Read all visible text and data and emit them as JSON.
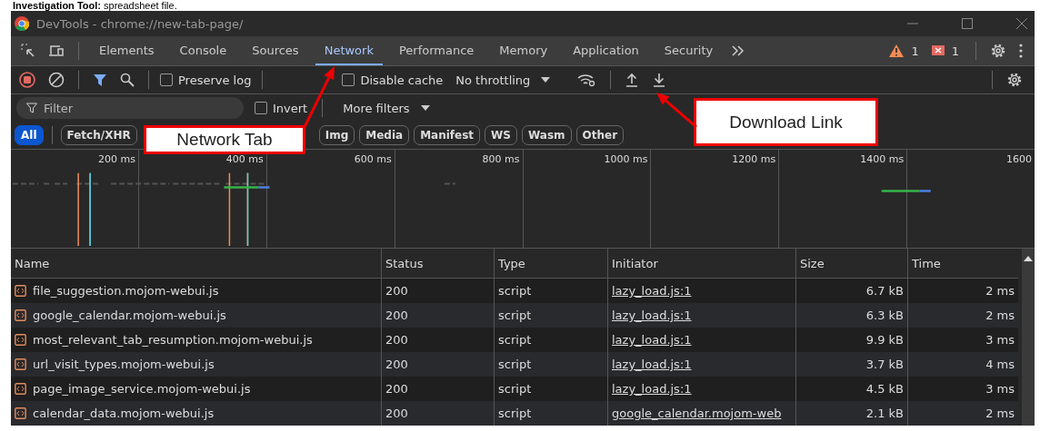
{
  "caption": "**Investigation Tool:** spreadsheet file.",
  "window": {
    "title": "DevTools - chrome://new-tab-page/"
  },
  "tabs": [
    {
      "label": "Elements",
      "selected": false
    },
    {
      "label": "Console",
      "selected": false
    },
    {
      "label": "Sources",
      "selected": false
    },
    {
      "label": "Network",
      "selected": true
    },
    {
      "label": "Performance",
      "selected": false
    },
    {
      "label": "Memory",
      "selected": false
    },
    {
      "label": "Application",
      "selected": false
    },
    {
      "label": "Security",
      "selected": false
    }
  ],
  "issues": {
    "warnings": "1",
    "errors": "1"
  },
  "toolbar": {
    "recording": true,
    "preserve_log": {
      "label": "Preserve log",
      "checked": false
    },
    "disable_cache": {
      "label": "Disable cache",
      "checked": false
    },
    "throttling": "No throttling"
  },
  "filter": {
    "placeholder": "Filter",
    "invert": {
      "label": "Invert",
      "checked": false
    },
    "more_filters": "More filters"
  },
  "type_filters": [
    {
      "label": "All",
      "selected": true
    },
    {
      "label": "Fetch/XHR",
      "selected": false
    },
    {
      "label": "Img",
      "selected": false
    },
    {
      "label": "Media",
      "selected": false
    },
    {
      "label": "Manifest",
      "selected": false
    },
    {
      "label": "WS",
      "selected": false
    },
    {
      "label": "Wasm",
      "selected": false
    },
    {
      "label": "Other",
      "selected": false
    }
  ],
  "overview": {
    "ticks": [
      "200 ms",
      "400 ms",
      "600 ms",
      "800 ms",
      "1000 ms",
      "1200 ms",
      "1400 ms",
      "1600"
    ]
  },
  "table": {
    "columns": [
      "Name",
      "Status",
      "Type",
      "Initiator",
      "Size",
      "Time"
    ],
    "rows": [
      {
        "name": "file_suggestion.mojom-webui.js",
        "status": "200",
        "type": "script",
        "initiator": "lazy_load.js:1",
        "size": "6.7 kB",
        "time": "2 ms"
      },
      {
        "name": "google_calendar.mojom-webui.js",
        "status": "200",
        "type": "script",
        "initiator": "lazy_load.js:1",
        "size": "6.3 kB",
        "time": "2 ms"
      },
      {
        "name": "most_relevant_tab_resumption.mojom-webui.js",
        "status": "200",
        "type": "script",
        "initiator": "lazy_load.js:1",
        "size": "9.9 kB",
        "time": "3 ms"
      },
      {
        "name": "url_visit_types.mojom-webui.js",
        "status": "200",
        "type": "script",
        "initiator": "lazy_load.js:1",
        "size": "3.7 kB",
        "time": "4 ms"
      },
      {
        "name": "page_image_service.mojom-webui.js",
        "status": "200",
        "type": "script",
        "initiator": "lazy_load.js:1",
        "size": "4.5 kB",
        "time": "3 ms"
      },
      {
        "name": "calendar_data.mojom-webui.js",
        "status": "200",
        "type": "script",
        "initiator": "google_calendar.mojom-web",
        "size": "2.1 kB",
        "time": "2 ms"
      }
    ]
  },
  "callouts": [
    {
      "text": "Network Tab"
    },
    {
      "text": "Download Link"
    }
  ]
}
